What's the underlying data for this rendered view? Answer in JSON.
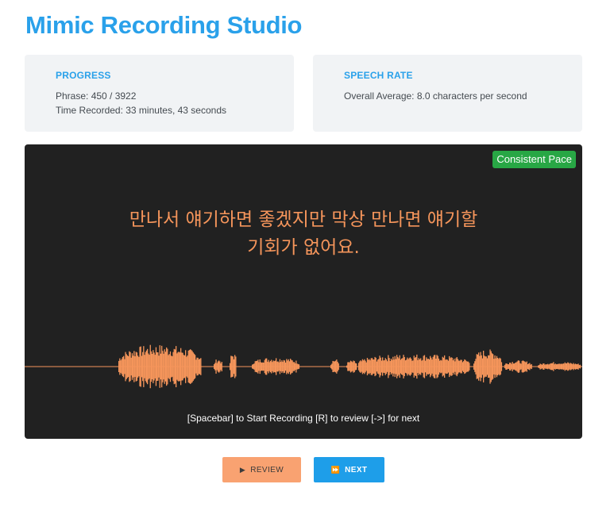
{
  "header": {
    "title": "Mimic Recording Studio"
  },
  "progress": {
    "heading": "PROGRESS",
    "phrase": "Phrase: 450 / 3922",
    "time_recorded": "Time Recorded: 33 minutes, 43 seconds"
  },
  "speech_rate": {
    "heading": "SPEECH RATE",
    "average": "Overall Average: 8.0 characters per second"
  },
  "studio": {
    "pace_badge": "Consistent Pace",
    "phrase_line1": "만나서 얘기하면 좋겠지만 막상 만나면 얘기할",
    "phrase_line2": "기회가 없어요.",
    "hint": "[Spacebar] to Start Recording [R] to review [->] for next",
    "waveform_color": "#f5955b",
    "panel_color": "#212121",
    "badge_color": "#28a745"
  },
  "controls": {
    "review_label": "REVIEW",
    "review_icon": "play-icon",
    "next_label": "NEXT",
    "next_icon": "fast-forward-icon",
    "review_color": "#f9a271",
    "next_color": "#1e9ee9"
  },
  "colors": {
    "accent": "#2aa1ea",
    "card_bg": "#f1f3f5"
  }
}
